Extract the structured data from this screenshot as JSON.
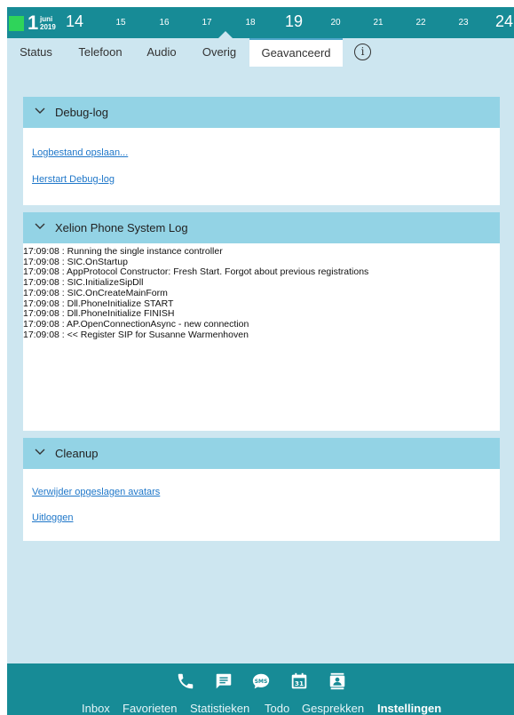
{
  "timeline": {
    "day": "1",
    "month": "juni",
    "year": "2019",
    "ticks": [
      "14",
      "15",
      "16",
      "17",
      "18",
      "19",
      "20",
      "21",
      "22",
      "23",
      "24"
    ]
  },
  "tabs": [
    {
      "label": "Status"
    },
    {
      "label": "Telefoon"
    },
    {
      "label": "Audio"
    },
    {
      "label": "Overig"
    },
    {
      "label": "Geavanceerd",
      "active": true
    }
  ],
  "info_icon": "i",
  "panels": {
    "debug": {
      "title": "Debug-log",
      "links": [
        "Logbestand opslaan...",
        "Herstart Debug-log"
      ]
    },
    "syslog": {
      "title": "Xelion Phone System Log",
      "lines": [
        "17:09:08 : Running the single instance controller",
        "17:09:08 : SIC.OnStartup",
        "17:09:08 : AppProtocol Constructor: Fresh Start. Forgot about previous registrations",
        "17:09:08 : SIC.InitializeSipDll",
        "17:09:08 : SIC.OnCreateMainForm",
        "17:09:08 : Dll.PhoneInitialize START",
        "17:09:08 : Dll.PhoneInitialize FINISH",
        "17:09:08 : AP.OpenConnectionAsync - new connection",
        "17:09:08 :  << Register SIP for Susanne Warmenhoven"
      ]
    },
    "cleanup": {
      "title": "Cleanup",
      "links": [
        "Verwijder opgeslagen avatars",
        "Uitloggen"
      ]
    }
  },
  "bottom": {
    "icons": [
      "phone-icon",
      "chat-icon",
      "sms-icon",
      "calendar-icon",
      "contacts-icon"
    ],
    "sms_text": "SMS",
    "calendar_text": "31",
    "nav": [
      "Inbox",
      "Favorieten",
      "Statistieken",
      "Todo",
      "Gesprekken",
      "Instellingen"
    ],
    "active_nav": "Instellingen"
  },
  "colors": {
    "bar": "#178b96",
    "content_bg": "#cde6f0",
    "panel_header": "#93d3e5",
    "link": "#1f77c9",
    "marker": "#2fd45a"
  }
}
